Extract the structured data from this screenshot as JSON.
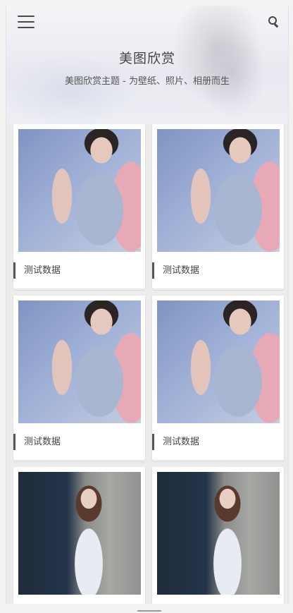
{
  "header": {
    "title": "美图欣赏",
    "subtitle": "美图欣赏主题 - 为壁纸、照片、相册而生"
  },
  "cards": [
    {
      "caption": "测试数据",
      "photo": "girl-in-knit-sweater"
    },
    {
      "caption": "测试数据",
      "photo": "girl-in-knit-sweater"
    },
    {
      "caption": "测试数据",
      "photo": "girl-in-knit-sweater"
    },
    {
      "caption": "测试数据",
      "photo": "girl-in-knit-sweater"
    },
    {
      "caption": "",
      "photo": "girl-in-floral-dress"
    },
    {
      "caption": "",
      "photo": "girl-in-floral-dress"
    }
  ],
  "icons": {
    "menu": "hamburger-menu-icon",
    "search": "search-icon"
  }
}
